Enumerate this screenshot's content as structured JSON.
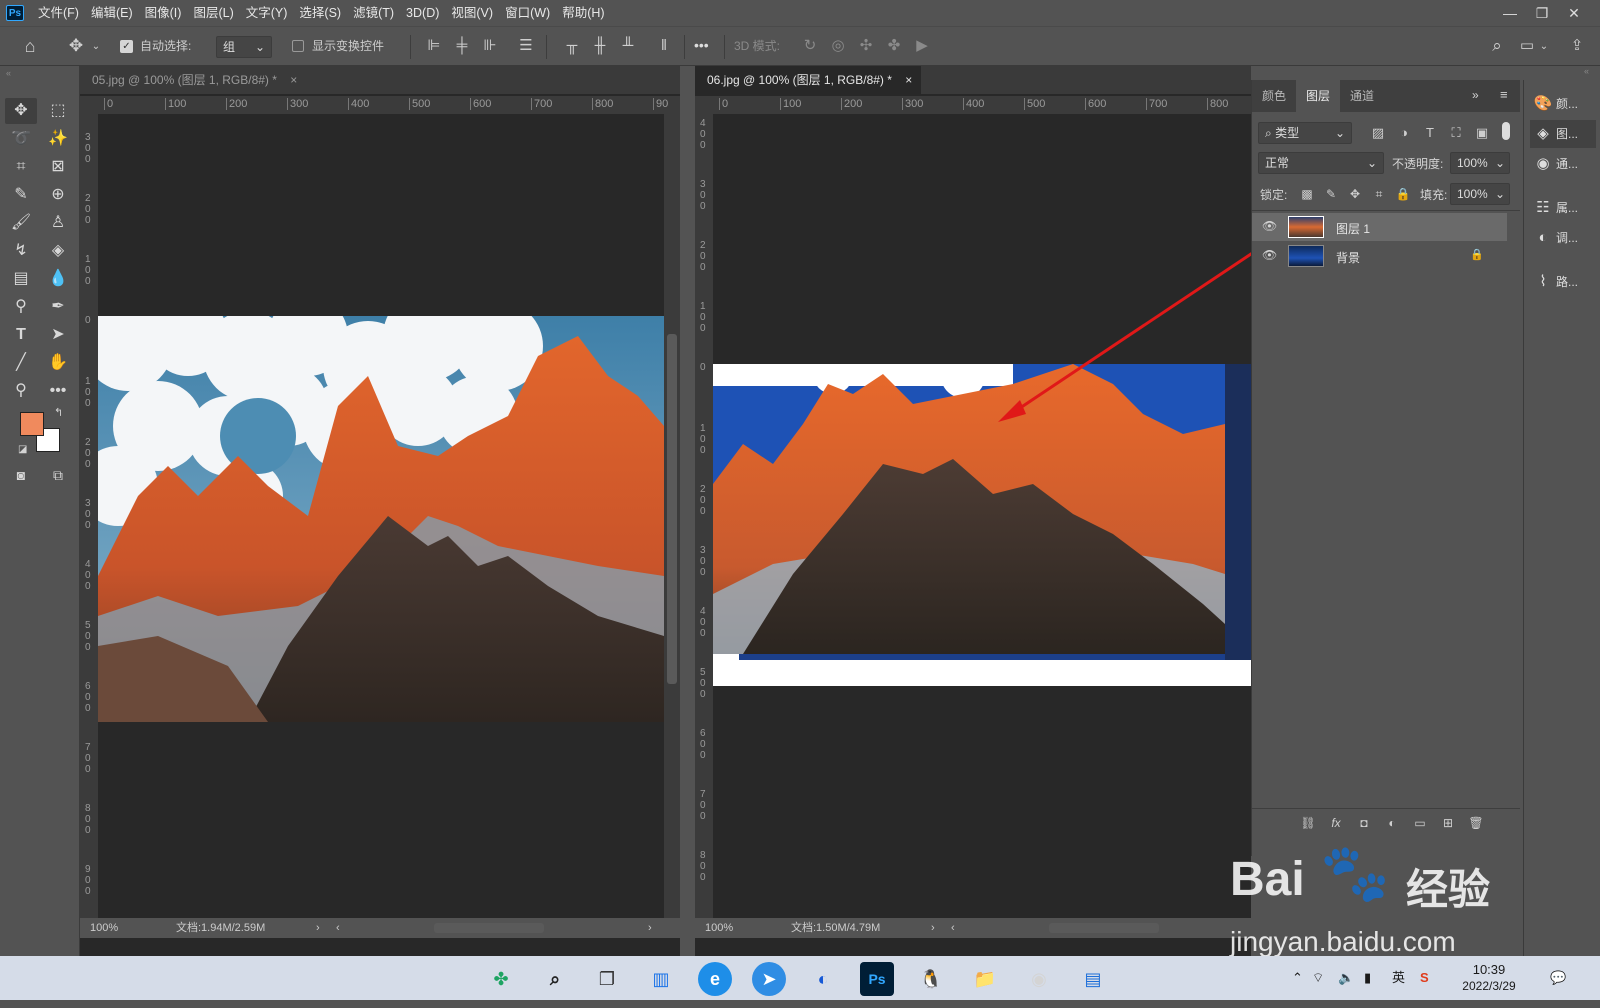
{
  "app": {
    "logo": "Ps"
  },
  "menu": [
    "文件(F)",
    "编辑(E)",
    "图像(I)",
    "图层(L)",
    "文字(Y)",
    "选择(S)",
    "滤镜(T)",
    "3D(D)",
    "视图(V)",
    "窗口(W)",
    "帮助(H)"
  ],
  "window_controls": {
    "minimize": "—",
    "restore": "❐",
    "close": "✕"
  },
  "options_bar": {
    "auto_select_label": "自动选择:",
    "auto_select_value": "组",
    "show_transform_label": "显示变换控件",
    "more": "•••",
    "mode_3d_label": "3D 模式:"
  },
  "tools": {
    "foreground_color": "#f08a5d",
    "background_color": "#ffffff"
  },
  "documents": [
    {
      "tab_title": "05.jpg @ 100% (图层 1, RGB/8#) *",
      "close": "×",
      "h_ruler": [
        "0",
        "100",
        "200",
        "300",
        "400",
        "500",
        "600",
        "700",
        "800",
        "90"
      ],
      "v_ruler": [
        "3 0 0",
        "2 0 0",
        "1 0 0",
        "0",
        "1 0 0",
        "2 0 0",
        "3 0 0",
        "4 0 0",
        "5 0 0",
        "6 0 0",
        "7 0 0",
        "8 0 0",
        "9 0 0"
      ],
      "zoom": "100%",
      "doc_size": "文档:1.94M/2.59M"
    },
    {
      "tab_title": "06.jpg @ 100% (图层 1, RGB/8#) *",
      "close": "×",
      "h_ruler": [
        "0",
        "100",
        "200",
        "300",
        "400",
        "500",
        "600",
        "700",
        "800"
      ],
      "v_ruler": [
        "4 0 0",
        "3 0 0",
        "2 0 0",
        "1 0 0",
        "0",
        "1 0 0",
        "2 0 0",
        "3 0 0",
        "4 0 0",
        "5 0 0",
        "6 0 0",
        "7 0 0",
        "8 0 0"
      ],
      "zoom": "100%",
      "doc_size": "文档:1.50M/4.79M"
    }
  ],
  "layers_panel": {
    "tabs": [
      "颜色",
      "图层",
      "通道"
    ],
    "active_tab": "图层",
    "filter_kind": "类型",
    "blend_mode": "正常",
    "opacity_label": "不透明度:",
    "opacity_value": "100%",
    "lock_label": "锁定:",
    "fill_label": "填充:",
    "fill_value": "100%",
    "layers": [
      {
        "name": "图层 1",
        "selected": true
      },
      {
        "name": "背景",
        "locked": true
      }
    ],
    "footer_fx": "fx"
  },
  "right_dock": [
    "颜...",
    "图...",
    "通...",
    "属...",
    "调...",
    "路..."
  ],
  "taskbar": {
    "tray_lang": "英",
    "time": "10:39",
    "date": "2022/3/29"
  },
  "watermark": {
    "brand": "Bai",
    "brand2": "经验",
    "url": "jingyan.baidu.com"
  }
}
